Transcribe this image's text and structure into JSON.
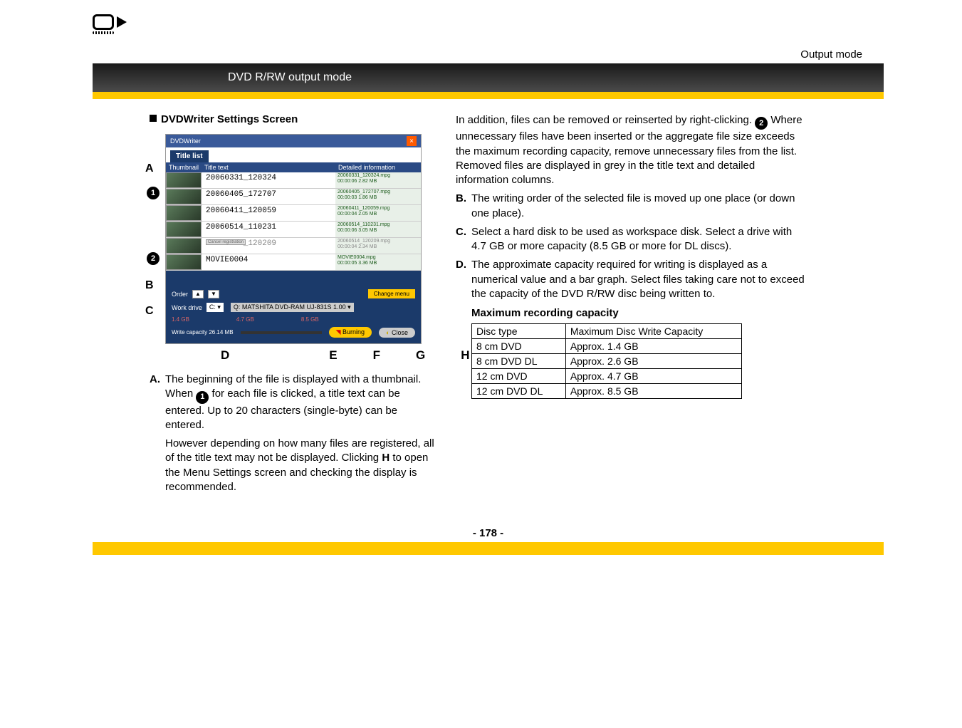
{
  "header": {
    "output_mode_label": "Output mode",
    "banner": "DVD R/RW output mode"
  },
  "section_title": "DVDWriter Settings Screen",
  "screenshot": {
    "window_title": "DVDWriter",
    "tab": "Title list",
    "cols": {
      "thumb": "Thumbnail",
      "title": "Title text",
      "det": "Detailed information"
    },
    "rows": [
      {
        "title": "20060331_120324",
        "det": "20060331_120324.mpg\n00:00:06 2.82 MB",
        "grey": false
      },
      {
        "title": "20060405_172707",
        "det": "20060405_172707.mpg\n00:00:03 1.86 MB",
        "grey": false
      },
      {
        "title": "20060411_120059",
        "det": "20060411_120059.mpg\n00:00:04 2.05 MB",
        "grey": false
      },
      {
        "title": "20060514_110231",
        "det": "20060514_110231.mpg\n00:00:06 3.05 MB",
        "grey": false
      },
      {
        "title": "20060514_120209",
        "det": "20060514_120209.mpg\n00:00:04 2.34 MB",
        "grey": true,
        "cancel": "Cancel registration"
      },
      {
        "title": "MOVIE0004",
        "det": "MOVIE0004.mpg\n00:00:05 3.36 MB",
        "grey": false
      }
    ],
    "order_label": "Order",
    "change_menu": "Change menu",
    "work_drive_label": "Work drive",
    "work_drive_letter": "C:",
    "drive_path": "Q: MATSHITA DVD-RAM UJ-831S 1.00",
    "g1": "1.4 GB",
    "g2": "4.7 GB",
    "g3": "8.5 GB",
    "write_cap": "Write capacity 26.14 MB",
    "burn": "Burning",
    "close": "Close"
  },
  "callouts": {
    "A": "A",
    "B": "B",
    "C": "C",
    "D": "D",
    "E": "E",
    "F": "F",
    "G": "G",
    "H": "H"
  },
  "nums": {
    "n1": "1",
    "n2": "2"
  },
  "left_body": {
    "a_label": "A.",
    "a_pre": "The beginning of the file is displayed with a thumbnail. When ",
    "a_post": " for each file is clicked, a title text can be entered. Up to 20 characters (single-byte) can be entered.",
    "a_p2_pre": "However depending on how many files are registered, all of the title text may not be displayed. Clicking ",
    "a_h": "H",
    "a_p2_post": " to open the Menu Settings screen and checking the display is recommended."
  },
  "right_body": {
    "intro_pre": "In addition, files can be removed or reinserted by right-clicking. ",
    "intro_post": " Where unnecessary files have been inserted or the aggregate file size exceeds the maximum recording capacity, remove unnecessary files from the list. Removed files are displayed in grey in the title text and detailed information columns.",
    "b_label": "B.",
    "b_text": "The writing order of the selected file is moved up one place (or down one place).",
    "c_label": "C.",
    "c_text": "Select a hard disk to be used as workspace disk. Select a drive with 4.7 GB or more capacity (8.5 GB or more for DL discs).",
    "d_label": "D.",
    "d_text": "The approximate capacity required for writing is displayed as a numerical value and a bar graph. Select files taking care not to exceed the capacity of the DVD R/RW disc being written to.",
    "max_title": "Maximum recording capacity",
    "table": {
      "h1": "Disc type",
      "h2": "Maximum Disc Write Capacity",
      "rows": [
        {
          "t": "8 cm DVD",
          "c": "Approx. 1.4 GB"
        },
        {
          "t": "8 cm DVD DL",
          "c": "Approx. 2.6 GB"
        },
        {
          "t": "12 cm DVD",
          "c": "Approx. 4.7 GB"
        },
        {
          "t": "12 cm DVD DL",
          "c": "Approx. 8.5 GB"
        }
      ]
    }
  },
  "page": "- 178 -"
}
